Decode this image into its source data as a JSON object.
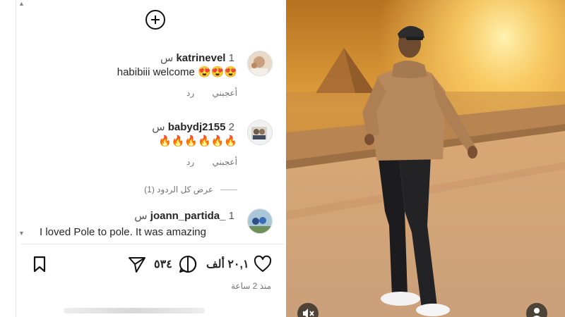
{
  "comments": [
    {
      "username": "katrinevel",
      "time": "1 س",
      "text": "habibiii welcome 😍😍😍",
      "like_label": "أعجبني",
      "reply_label": "رد"
    },
    {
      "username": "babydj2155",
      "time": "2 س",
      "text": "🔥🔥🔥🔥🔥🔥",
      "like_label": "أعجبني",
      "reply_label": "رد"
    },
    {
      "username": "joann_partida_",
      "time": "1 س",
      "text": "I loved Pole to pole. It was amazing"
    }
  ],
  "view_replies": "عرض كل الردود (1)",
  "actions": {
    "likes_count": "٢٠,١ ألف",
    "comments_count": "٥٣٤",
    "time_ago": "منذ 2 ساعة"
  },
  "icons": {
    "add": "plus-circle-icon",
    "like": "heart-icon",
    "comment": "comment-icon",
    "share": "send-icon",
    "save": "bookmark-icon",
    "mute": "speaker-muted-icon",
    "tags": "person-icon"
  },
  "colors": {
    "text": "#262626",
    "muted": "#737373",
    "sky_top": "#c77a2a",
    "sun_glow": "#ffd36a"
  }
}
